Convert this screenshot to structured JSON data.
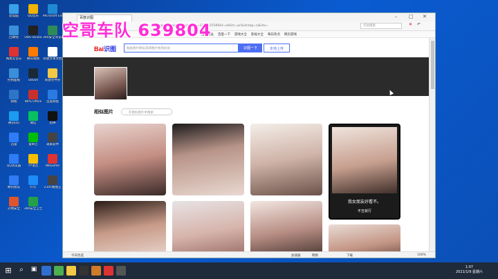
{
  "overlay": {
    "banner": "空哥车队  639804"
  },
  "desktop": {
    "icons": [
      {
        "label": "此电脑",
        "color": "#3aa0e8"
      },
      {
        "label": "QQ音乐",
        "color": "#f0b400"
      },
      {
        "label": "Microsoft Edge",
        "color": "#1f8ad2"
      },
      {
        "label": "回收站",
        "color": "#3a8fd8"
      },
      {
        "label": "OBS Studio",
        "color": "#222222"
      },
      {
        "label": "360安全浏览器",
        "color": "#2e8b57"
      },
      {
        "label": "网易云音乐",
        "color": "#d33"
      },
      {
        "label": "腾讯视频",
        "color": "#ff7a00"
      },
      {
        "label": "新建文本文档",
        "color": "#ffffff"
      },
      {
        "label": "控制面板",
        "color": "#3a8fd8"
      },
      {
        "label": "Steam",
        "color": "#1b2838"
      },
      {
        "label": "新建文件夹",
        "color": "#f3c846"
      },
      {
        "label": "网络",
        "color": "#2e75c7"
      },
      {
        "label": "WPS Office",
        "color": "#c9302c"
      },
      {
        "label": "百度网盘",
        "color": "#2a7ae2"
      },
      {
        "label": "腾讯QQ",
        "color": "#1d9bf0"
      },
      {
        "label": "微信",
        "color": "#07c160"
      },
      {
        "label": "剪映",
        "color": "#111111"
      },
      {
        "label": "迅雷",
        "color": "#2f7cf6"
      },
      {
        "label": "爱奇艺",
        "color": "#00be06"
      },
      {
        "label": "录屏软件",
        "color": "#444444"
      },
      {
        "label": "QQ浏览器",
        "color": "#2f7cf6"
      },
      {
        "label": "YY语音",
        "color": "#f6c000"
      },
      {
        "label": "WeGame",
        "color": "#d33"
      },
      {
        "label": "腾讯会议",
        "color": "#2f7cf6"
      },
      {
        "label": "钉钉",
        "color": "#1d8cf8"
      },
      {
        "label": "2345看图王",
        "color": "#444444"
      },
      {
        "label": "火绒安全",
        "color": "#e0542e"
      },
      {
        "label": "360安全卫士",
        "color": "#24a148"
      }
    ]
  },
  "browser": {
    "tab_title": "百度识图",
    "url": "graph.baidu.com/s?sign=1210125566&f=all&tn=pc&idctag=nj&idx=",
    "search_placeholder": "点此搜索",
    "favorites": [
      "推荐网址",
      "百度一下",
      "游戏大全",
      "影视大全",
      "每日热点",
      "网页游戏"
    ],
    "logo_left": "Bai",
    "logo_right": "识图",
    "input_placeholder": "粘贴图片网址或将图片拖到此处",
    "search_button": "识图一下",
    "upload_button": "本地上传",
    "similar_title": "相似图片",
    "similar_search_placeholder": "在相似图片中搜索",
    "card4_caption": "我女朋友好看不。",
    "card4_sub": "不丑就行",
    "status": {
      "left": "今日优选",
      "items": [
        "加速器",
        "网络",
        "下载",
        "",
        "100%"
      ]
    }
  },
  "taskbar": {
    "time": "1:07",
    "date": "2021/1/9 星期六"
  }
}
